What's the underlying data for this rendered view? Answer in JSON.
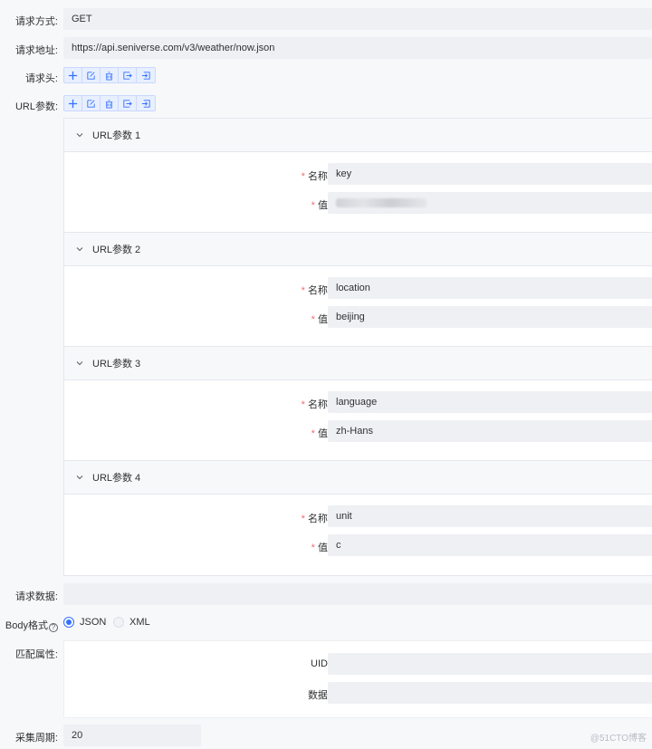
{
  "method": {
    "label": "请求方式:",
    "value": "GET"
  },
  "url": {
    "label": "请求地址:",
    "value": "https://api.seniverse.com/v3/weather/now.json"
  },
  "headers": {
    "label": "请求头:"
  },
  "url_params": {
    "label": "URL参数:",
    "items": [
      {
        "title": "URL参数 1",
        "name_label": "名称:",
        "name": "key",
        "value_label": "值:",
        "value": ""
      },
      {
        "title": "URL参数 2",
        "name_label": "名称:",
        "name": "location",
        "value_label": "值:",
        "value": "beijing"
      },
      {
        "title": "URL参数 3",
        "name_label": "名称:",
        "name": "language",
        "value_label": "值:",
        "value": "zh-Hans"
      },
      {
        "title": "URL参数 4",
        "name_label": "名称:",
        "name": "unit",
        "value_label": "值:",
        "value": "c"
      }
    ]
  },
  "request_data": {
    "label": "请求数据:",
    "value": ""
  },
  "body_format": {
    "label": "Body格式",
    "options": [
      "JSON",
      "XML"
    ],
    "selected": "JSON"
  },
  "match": {
    "label": "匹配属性:",
    "uid_label": "UID:",
    "data_label": "数据:",
    "uid": "",
    "data": ""
  },
  "period": {
    "label": "采集周期:",
    "value": "20"
  },
  "required_mark": "*",
  "help_mark": "?",
  "watermark": "@51CTO博客",
  "colors": {
    "accent": "#3370ff",
    "required": "#f56c6c",
    "field_bg": "#eef0f3"
  },
  "toolbar_icons": [
    "plus-icon",
    "edit-icon",
    "delete-icon",
    "import-icon",
    "export-icon"
  ]
}
